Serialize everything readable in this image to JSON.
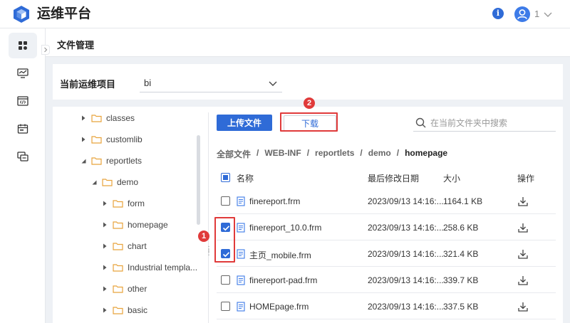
{
  "app": {
    "title": "运维平台",
    "user_name": "1"
  },
  "page": {
    "title": "文件管理"
  },
  "project": {
    "label": "当前运维项目",
    "value": "bi"
  },
  "tree": {
    "items": [
      {
        "label": "classes",
        "expanded": false
      },
      {
        "label": "customlib",
        "expanded": false
      },
      {
        "label": "reportlets",
        "expanded": true
      },
      {
        "label": "demo",
        "expanded": true
      },
      {
        "label": "form",
        "expanded": false
      },
      {
        "label": "homepage",
        "expanded": false
      },
      {
        "label": "chart",
        "expanded": false
      },
      {
        "label": "Industrial templa...",
        "expanded": false
      },
      {
        "label": "other",
        "expanded": false
      },
      {
        "label": "basic",
        "expanded": false
      }
    ]
  },
  "toolbar": {
    "upload_label": "上传文件",
    "download_label": "下载",
    "search_placeholder": "在当前文件夹中搜索"
  },
  "breadcrumb": [
    "全部文件",
    "WEB-INF",
    "reportlets",
    "demo",
    "homepage"
  ],
  "table": {
    "headers": {
      "name": "名称",
      "date": "最后修改日期",
      "size": "大小",
      "op": "操作"
    },
    "rows": [
      {
        "name": "finereport.frm",
        "date": "2023/09/13 14:16:...",
        "size": "1164.1 KB",
        "checked": false
      },
      {
        "name": "finereport_10.0.frm",
        "date": "2023/09/13 14:16:...",
        "size": "258.6 KB",
        "checked": true
      },
      {
        "name": "主页_mobile.frm",
        "date": "2023/09/13 14:16:...",
        "size": "321.4 KB",
        "checked": true
      },
      {
        "name": "finereport-pad.frm",
        "date": "2023/09/13 14:16:...",
        "size": "339.7 KB",
        "checked": false
      },
      {
        "name": "HOMEpage.frm",
        "date": "2023/09/13 14:16:...",
        "size": "337.5 KB",
        "checked": false
      }
    ]
  },
  "annotations": {
    "marker_1": "1",
    "marker_2": "2"
  },
  "colors": {
    "accent": "#2f6bd7",
    "highlight": "#e03a3a"
  },
  "icons": {
    "logo": "cube-logo-icon",
    "info": "info-icon",
    "avatar": "user-avatar-icon",
    "sidebar": [
      "dashboard-icon",
      "monitor-icon",
      "code-window-icon",
      "calendar-icon",
      "window-stack-icon"
    ],
    "folder": "folder-icon",
    "file": "document-icon",
    "download": "download-icon",
    "search": "search-icon"
  }
}
